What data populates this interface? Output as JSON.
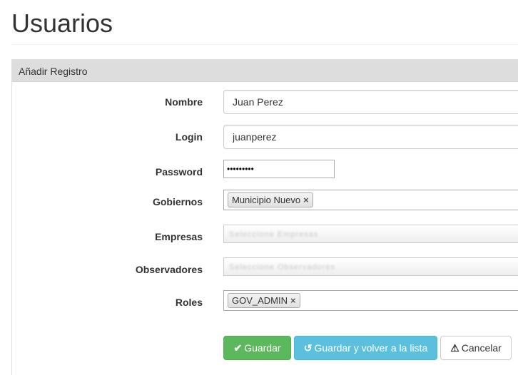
{
  "page": {
    "title": "Usuarios"
  },
  "panel": {
    "heading": "Añadir Registro"
  },
  "form": {
    "nombre": {
      "label": "Nombre",
      "value": "Juan Perez"
    },
    "login": {
      "label": "Login",
      "value": "juanperez"
    },
    "password": {
      "label": "Password",
      "value": "•••••••••"
    },
    "gobiernos": {
      "label": "Gobiernos",
      "tags": [
        "Municipio Nuevo"
      ]
    },
    "empresas": {
      "label": "Empresas",
      "placeholder": "Seleccione Empresas"
    },
    "observadores": {
      "label": "Observadores",
      "placeholder": "Seleccione Observadores"
    },
    "roles": {
      "label": "Roles",
      "tags": [
        "GOV_ADMIN"
      ]
    }
  },
  "buttons": {
    "save": {
      "label": "Guardar",
      "icon": "check-icon"
    },
    "save_and_return": {
      "label": "Guardar y volver a la lista",
      "icon": "undo-icon"
    },
    "cancel": {
      "label": "Cancelar",
      "icon": "warning-icon"
    }
  },
  "icons": {
    "tag_remove": "×"
  },
  "colors": {
    "success": "#5cb85c",
    "info": "#5bc0de",
    "panel_heading": "#dddddd"
  }
}
